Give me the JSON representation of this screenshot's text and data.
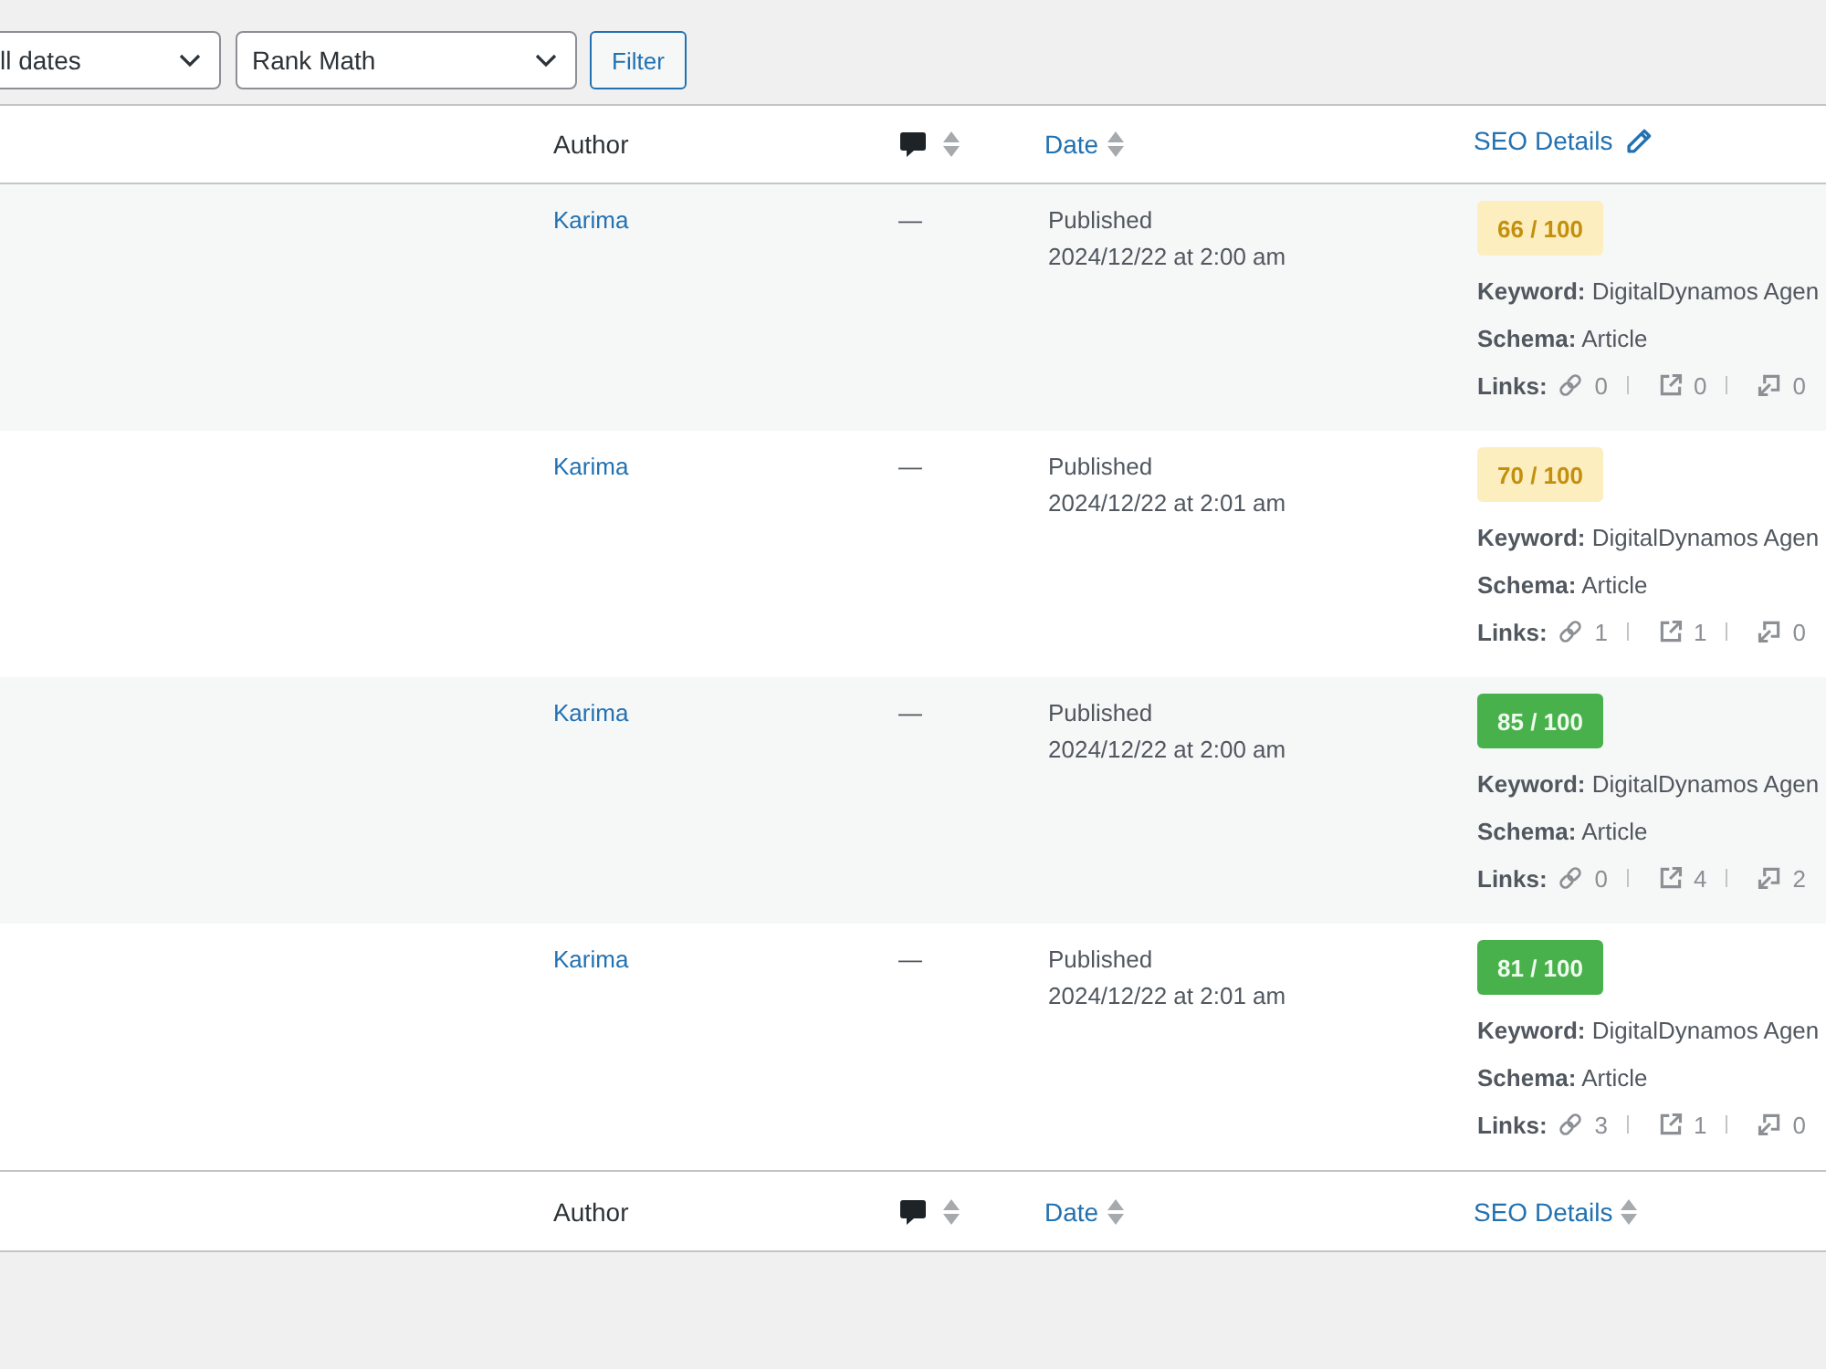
{
  "filters": {
    "date_select": "ll dates",
    "seo_select": "Rank Math",
    "filter_button": "Filter"
  },
  "table": {
    "header": [
      {
        "kind": "text",
        "label": "Author",
        "sortable": false,
        "editable": false
      },
      {
        "kind": "comments",
        "sortable": true,
        "editable": false
      },
      {
        "kind": "link",
        "label": "Date",
        "sortable": true,
        "editable": false
      },
      {
        "kind": "link",
        "label": "SEO Details",
        "sortable": false,
        "editable": true
      }
    ],
    "rows": [
      {
        "author": "Karima",
        "comments": "—",
        "status": "Published",
        "date": "2024/12/22 at 2:00 am",
        "seo": {
          "score": "66 / 100",
          "kind": "average",
          "keyword": "**Keyword:** DigitalDynamos Agen",
          "schema": "**Schema:** Article",
          "links_label": "Links:",
          "internal_links": "0",
          "external_links": "0",
          "incoming_links": "0"
        }
      },
      {
        "author": "Karima",
        "comments": "—",
        "status": "Published",
        "date": "2024/12/22 at 2:01 am",
        "seo": {
          "score": "70 / 100",
          "kind": "average",
          "keyword": "**Keyword:** DigitalDynamos Agen",
          "schema": "**Schema:** Article",
          "links_label": "Links:",
          "internal_links": "1",
          "external_links": "1",
          "incoming_links": "0"
        }
      },
      {
        "author": "Karima",
        "comments": "—",
        "status": "Published",
        "date": "2024/12/22 at 2:00 am",
        "seo": {
          "score": "85 / 100",
          "kind": "good",
          "keyword": "**Keyword:** DigitalDynamos Agen",
          "schema": "**Schema:** Article",
          "links_label": "Links:",
          "internal_links": "0",
          "external_links": "4",
          "incoming_links": "2"
        }
      },
      {
        "author": "Karima",
        "comments": "—",
        "status": "Published",
        "date": "2024/12/22 at 2:01 am",
        "seo": {
          "score": "81 / 100",
          "kind": "good",
          "keyword": "**Keyword:** DigitalDynamos Agen",
          "schema": "**Schema:** Article",
          "links_label": "Links:",
          "internal_links": "3",
          "external_links": "1",
          "incoming_links": "0"
        }
      }
    ],
    "footer": [
      {
        "kind": "text",
        "label": "Author",
        "sortable": false,
        "editable": false
      },
      {
        "kind": "comments",
        "sortable": true,
        "editable": false
      },
      {
        "kind": "link",
        "label": "Date",
        "sortable": true,
        "editable": false
      },
      {
        "kind": "link",
        "label": "SEO Details",
        "sortable": true,
        "editable": false
      }
    ]
  }
}
